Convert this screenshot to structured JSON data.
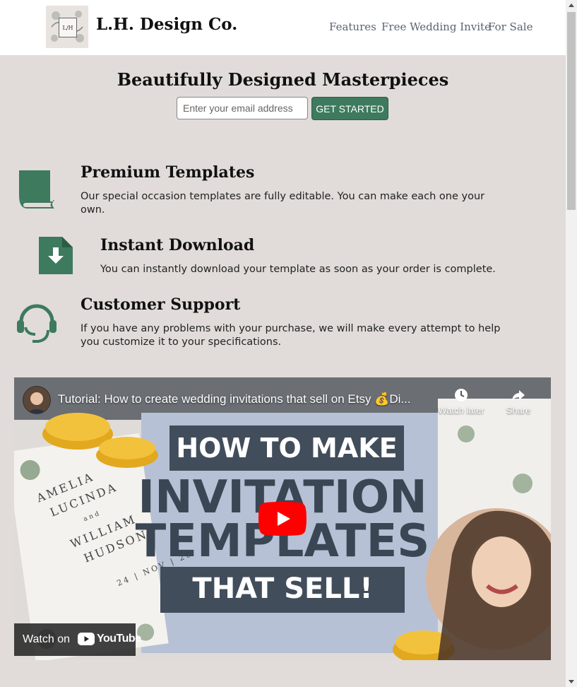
{
  "header": {
    "logo_text": "L/H",
    "brand": "L.H. Design Co.",
    "nav": [
      "Features",
      "Free Wedding Invite",
      "For Sale"
    ]
  },
  "hero": {
    "title": "Beautifully Designed Masterpieces",
    "email_placeholder": "Enter your email address",
    "cta_label": "GET STARTED"
  },
  "features": [
    {
      "icon": "book-icon",
      "title": "Premium Templates",
      "line1": "Our special occasion templates are fully editable. You can make each one your",
      "line2": "own."
    },
    {
      "icon": "file-download-icon",
      "title": "Instant Download",
      "line1": "You can instantly download your template as soon as your order is complete.",
      "line2": ""
    },
    {
      "icon": "headset-icon",
      "title": "Customer Support",
      "line1": "If you have any problems with your purchase, we will make every attempt to help",
      "line2": "you customize it to your specifications."
    }
  ],
  "video": {
    "title": "Tutorial: How to create wedding invitations that sell on Etsy 💰Di...",
    "watch_later": "Watch later",
    "share": "Share",
    "banner_top": "HOW TO MAKE",
    "banner_mid1": "INVITATION",
    "banner_mid2": "TEMPLATES",
    "banner_bottom": "THAT SELL!",
    "invite_names": [
      "AMELIA",
      "LUCINDA",
      "and",
      "WILLIAM",
      "HUDSON"
    ],
    "invite_date": "24 | NOV | 20",
    "watch_on": "Watch on",
    "youtube": "YouTube"
  },
  "colors": {
    "accent": "#3d7a5e",
    "background": "#e1dcd9",
    "banner_dark": "#424d5b"
  }
}
